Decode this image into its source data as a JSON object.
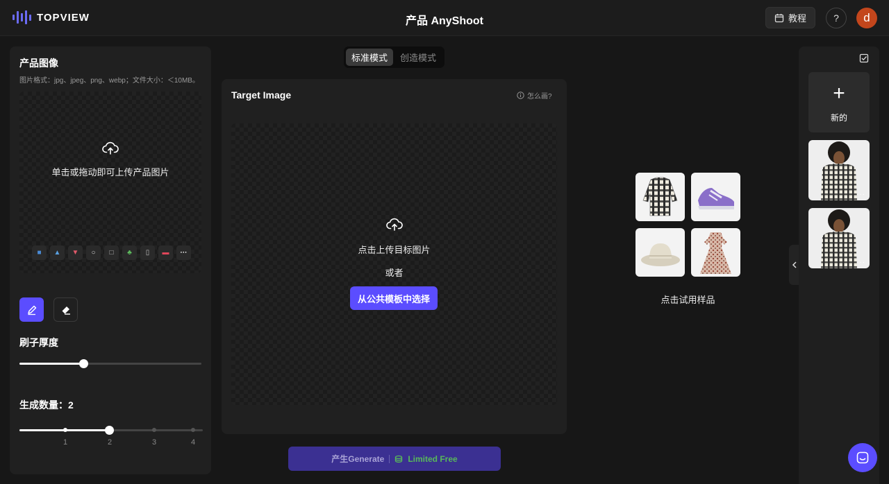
{
  "header": {
    "brand": "TOPVIEW",
    "title": "产品 AnyShoot",
    "tutorial_label": "教程",
    "help_label": "?",
    "avatar_letter": "d"
  },
  "left": {
    "title": "产品图像",
    "subtitle": "图片格式：jpg、jpeg、png、webp；文件大小：＜10MB。",
    "upload_text": "单击或拖动即可上传产品图片",
    "categories": [
      "jacket-icon",
      "dress-icon",
      "shoe-icon",
      "ring-icon",
      "box-icon",
      "plant-icon",
      "phone-icon",
      "car-icon",
      "more-icon"
    ],
    "more_label": "···",
    "brush_label": "刷子厚度",
    "brush_level_percent": 35,
    "count_label": "生成数量：",
    "count_value": "2",
    "count_ticks": [
      "1",
      "2",
      "3",
      "4"
    ]
  },
  "mode": {
    "standard": "标准模式",
    "creative": "创造模式"
  },
  "center": {
    "title": "Target Image",
    "how_link": "怎么画?",
    "upload_text": "点击上传目标图片",
    "or_text": "或者",
    "template_button": "从公共模板中选择"
  },
  "generate": {
    "label": "产生Generate",
    "free_label": "Limited Free"
  },
  "samples": {
    "label": "点击试用样品",
    "items": [
      "plaid-shirt",
      "purple-sneaker",
      "bucket-hat",
      "floral-dress"
    ]
  },
  "history": {
    "new_label": "新的",
    "more_label": "···"
  },
  "colors": {
    "accent": "#5b4dff",
    "free": "#58b85a",
    "avatar": "#c3461c"
  }
}
